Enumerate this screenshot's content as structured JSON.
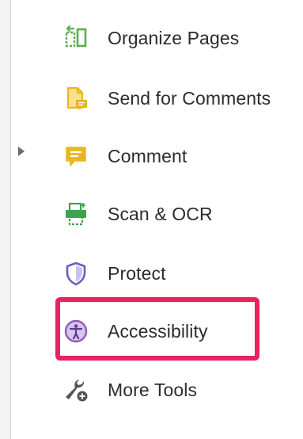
{
  "tools": [
    {
      "label": "Organize Pages",
      "icon": "organize-pages-icon",
      "color": "#5cae4f"
    },
    {
      "label": "Send for Comments",
      "icon": "send-for-comments-icon",
      "color": "#e9b620"
    },
    {
      "label": "Comment",
      "icon": "comment-icon",
      "color": "#e9b620"
    },
    {
      "label": "Scan & OCR",
      "icon": "scan-ocr-icon",
      "color": "#3fa34d"
    },
    {
      "label": "Protect",
      "icon": "protect-icon",
      "color": "#6a5fc1"
    },
    {
      "label": "Accessibility",
      "icon": "accessibility-icon",
      "color": "#8a5bb8"
    },
    {
      "label": "More Tools",
      "icon": "more-tools-icon",
      "color": "#555555"
    }
  ],
  "highlight_color": "#e8235f"
}
